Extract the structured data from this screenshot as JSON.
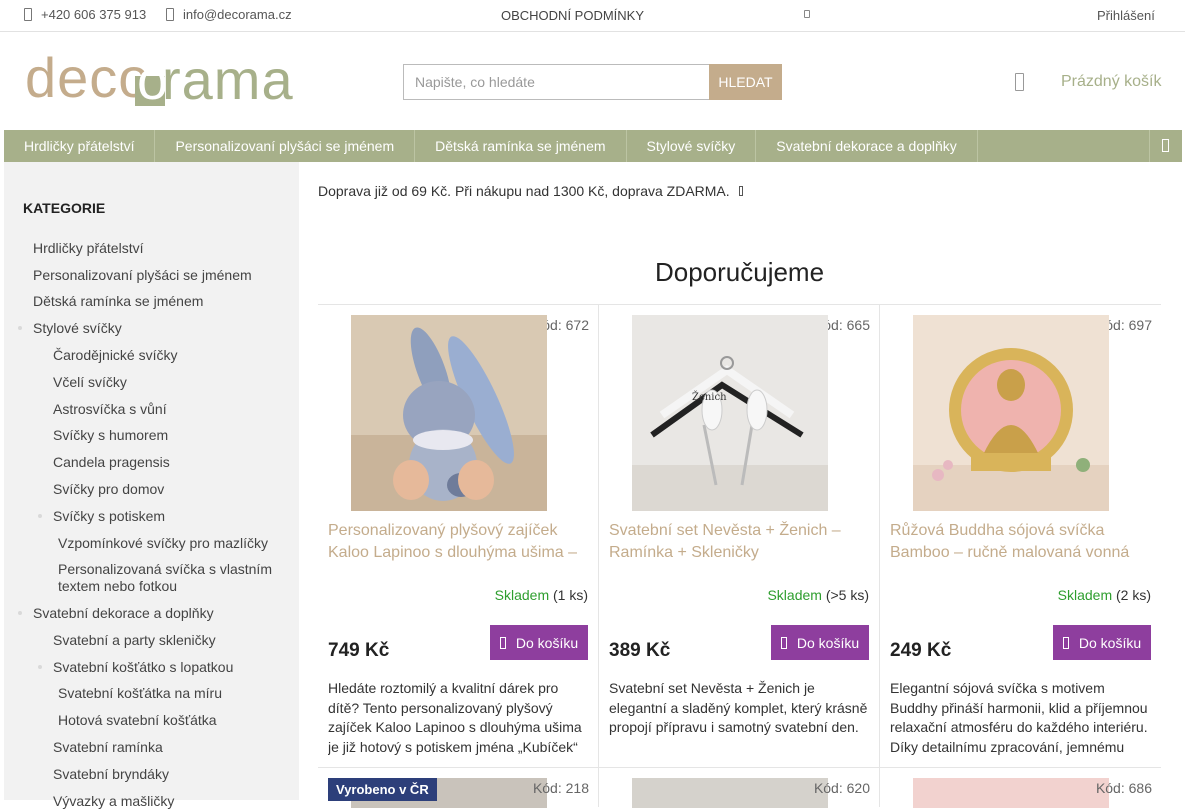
{
  "topbar": {
    "phone": "+420 606 375 913",
    "email": "info@decorama.cz",
    "terms": "OBCHODNÍ PODMÍNKY",
    "login": "Přihlášení"
  },
  "header": {
    "logo_left": "deco",
    "logo_right": "rama",
    "logo_o": "o",
    "search_placeholder": "Napište, co hledáte",
    "search_button": "HLEDAT",
    "cart": "Prázdný košík"
  },
  "nav": {
    "items": [
      "Hrdličky přátelství",
      "Personalizovaní plyšáci se jménem",
      "Dětská ramínka se jménem",
      "Stylové svíčky",
      "Svatební dekorace a doplňky"
    ]
  },
  "sidebar": {
    "title": "KATEGORIE",
    "items": [
      "Hrdličky přátelství",
      "Personalizovaní plyšáci se jménem",
      "Dětská ramínka se jménem",
      "Stylové svíčky",
      "Čarodějnické svíčky",
      "Včelí svíčky",
      "Astrosvíčka s vůní",
      "Svíčky s humorem",
      "Candela pragensis",
      "Svíčky pro domov",
      "Svíčky s potiskem",
      "Vzpomínkové svíčky pro mazlíčky",
      "Personalizovaná svíčka s vlastním textem nebo fotkou",
      "Svatební dekorace a doplňky",
      "Svatební a party skleničky",
      "Svatební košťátko s lopatkou",
      "Svatební košťátka na míru",
      "Hotová svatební košťátka",
      "Svatební ramínka",
      "Svatební bryndáky",
      "Vývazky a mašličky"
    ]
  },
  "main": {
    "shipping": "Doprava již od 69 Kč. Při nákupu nad 1300 Kč, doprava ZDARMA.",
    "section_title": "Doporučujeme",
    "stock_label": "Skladem",
    "buy_label": "Do košíku",
    "products": [
      {
        "code": "Kód: 672",
        "name": "Personalizovaný plyšový zajíček Kaloo Lapinoo s dlouhýma ušima –",
        "stock_qty": "(1 ks)",
        "price": "749 Kč",
        "desc": "Hledáte roztomilý a kvalitní dárek pro dítě? Tento personalizovaný plyšový zajíček Kaloo Lapinoo s dlouhýma ušima je již hotový s potiskem jména „Kubíček“"
      },
      {
        "code": "Kód: 665",
        "name": "Svatební set Nevěsta + Ženich – Ramínka + Skleničky",
        "stock_qty": "(>5 ks)",
        "price": "389 Kč",
        "desc": "Svatební set Nevěsta + Ženich je elegantní a sladěný komplet, který krásně propojí přípravu i samotný svatební den."
      },
      {
        "code": "Kód: 697",
        "name": "Růžová Buddha sójová svíčka Bamboo – ručně malovaná vonná",
        "stock_qty": "(2 ks)",
        "price": "249 Kč",
        "desc": "Elegantní sójová svíčka s motivem Buddhy přináší harmonii, klid a příjemnou relaxační atmosféru do každého interiéru. Díky detailnímu zpracování, jemnému"
      }
    ],
    "row2": [
      {
        "code": "Kód: 218",
        "badge": "Vyrobeno v ČR"
      },
      {
        "code": "Kód: 620"
      },
      {
        "code": "Kód: 686"
      }
    ]
  }
}
